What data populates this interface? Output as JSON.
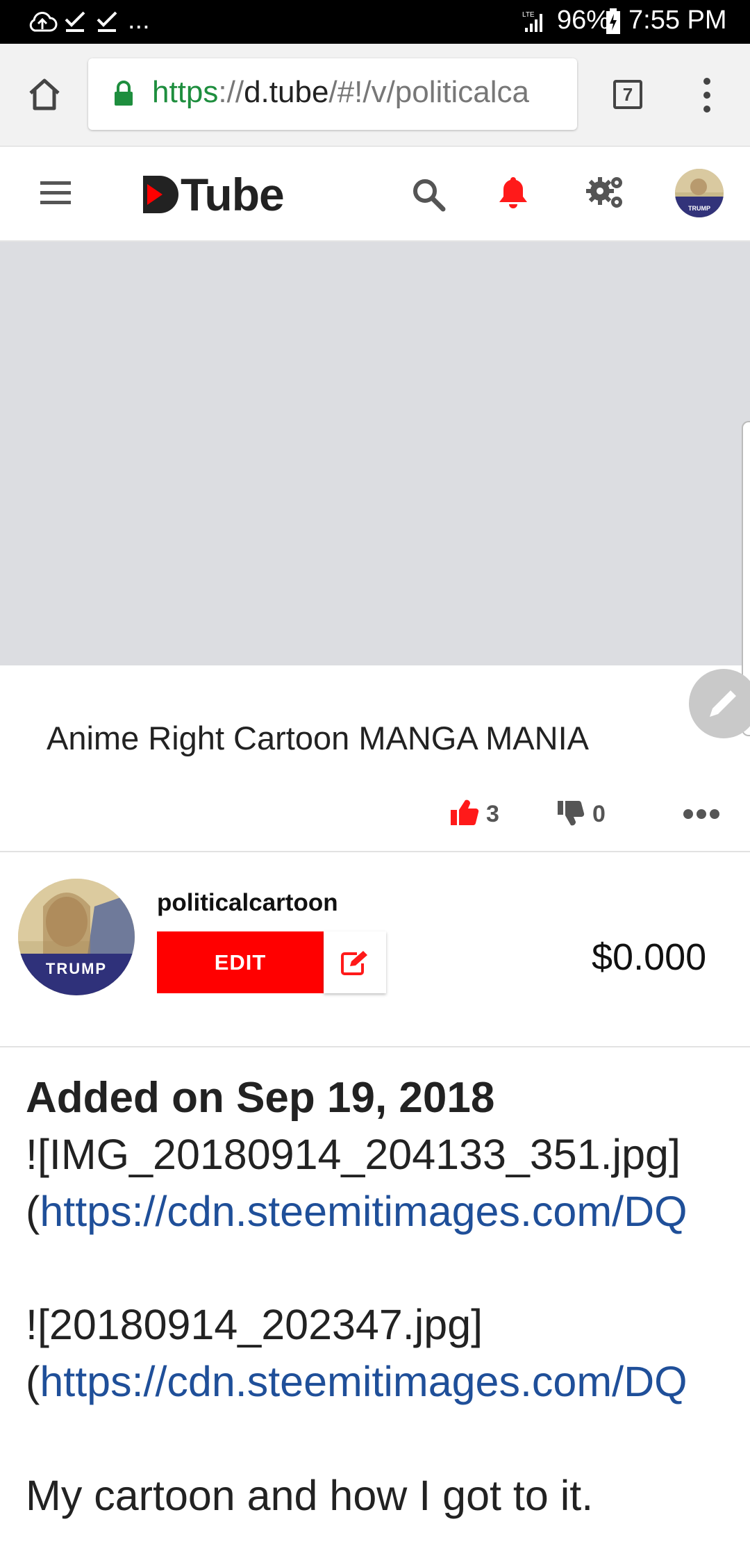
{
  "status_bar": {
    "battery": "96%",
    "time": "7:55 PM",
    "overflow": "..."
  },
  "browser": {
    "url_scheme": "https",
    "url_sep": "://",
    "url_host": "d.tube",
    "url_path": "/#!/v/politicalca",
    "tab_count": "7"
  },
  "header": {
    "logo_text": "Tube"
  },
  "video": {
    "title": "Anime Right Cartoon MANGA MANIA",
    "likes": "3",
    "dislikes": "0"
  },
  "author": {
    "name": "politicalcartoon",
    "avatar_text": "TRUMP",
    "edit_label": "EDIT",
    "payout": "$0.000"
  },
  "description": {
    "added": "Added on Sep 19, 2018",
    "img1_alt": "![IMG_20180914_204133_351.jpg]",
    "img1_link": "https://cdn.steemitimages.com/DQ",
    "img2_alt": "![20180914_202347.jpg]",
    "img2_link": "https://cdn.steemitimages.com/DQ",
    "paragraph": "My cartoon and how I got to it.",
    "paren": "("
  },
  "colors": {
    "brand_red": "#ff0000",
    "link_blue": "#1f4f99",
    "secure_green": "#1e8e3e"
  }
}
